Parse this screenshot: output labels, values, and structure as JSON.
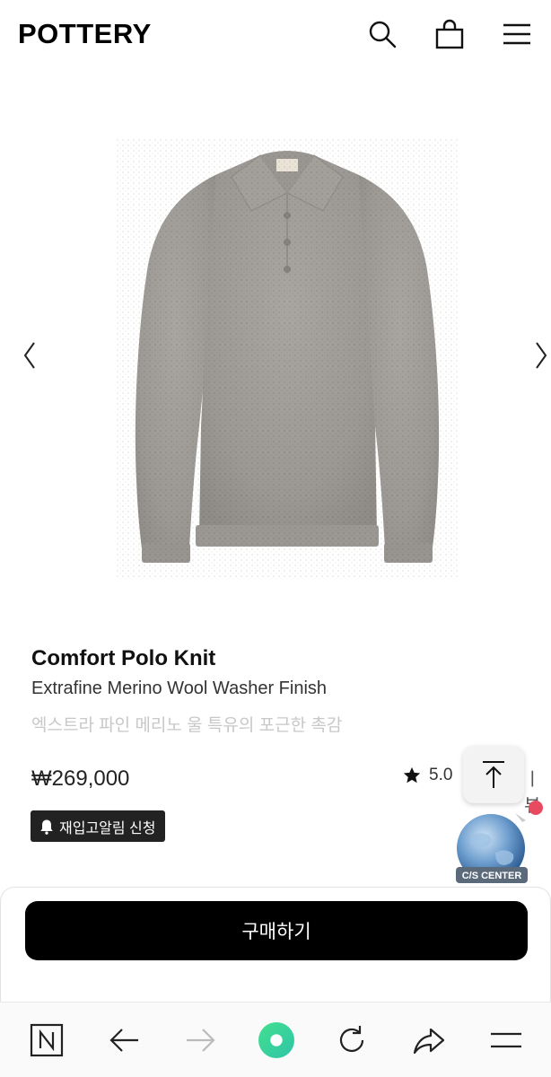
{
  "header": {
    "logo": "POTTERY",
    "icons": [
      "search-icon",
      "shopping-bag-icon",
      "menu-icon"
    ]
  },
  "gallery": {
    "prev_icon": "chevron-left-icon",
    "next_icon": "chevron-right-icon"
  },
  "product": {
    "name": "Comfort Polo Knit",
    "subtitle_en": "Extrafine Merino Wool Washer Finish",
    "subtitle_ko": "엑스트라 파인 메리노 울 특유의 포근한 촉감",
    "price": "₩269,000",
    "rating": "5.0",
    "review_partial": "ㅣ뷰"
  },
  "restock": {
    "label": "재입고알림 신청"
  },
  "floating": {
    "cs_label": "C/S CENTER"
  },
  "purchase": {
    "buy_label": "구매하기"
  },
  "browser_bar": {
    "icons": [
      "naver-n-icon",
      "back-arrow-icon",
      "forward-arrow-icon",
      "home-green-dot-icon",
      "reload-icon",
      "share-icon",
      "menu-icon"
    ]
  },
  "colors": {
    "accent_green": "#3ddc84",
    "buy_button": "#000000",
    "restock_badge": "#222222"
  }
}
